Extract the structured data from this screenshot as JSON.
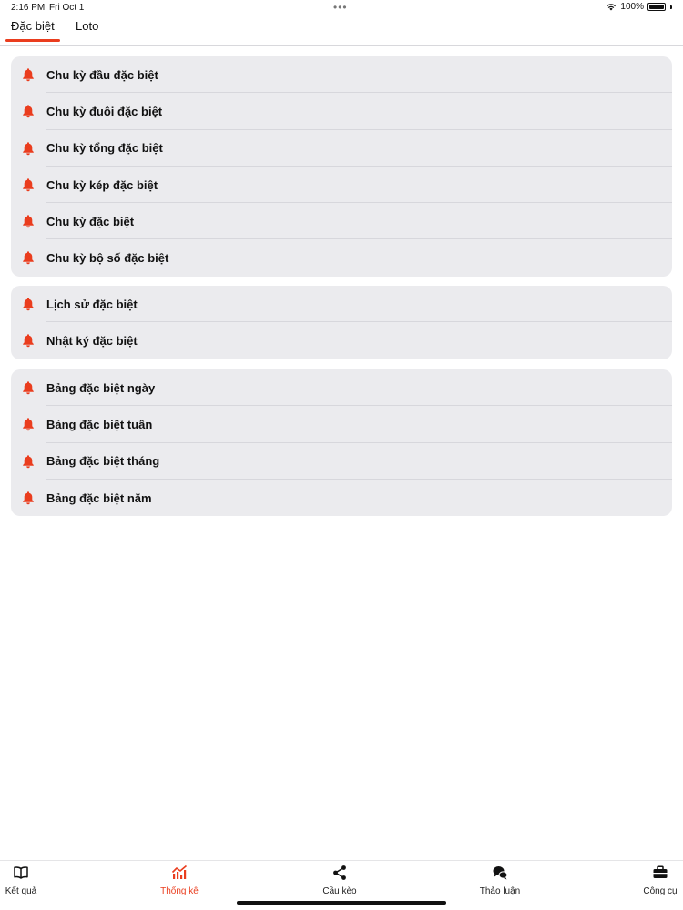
{
  "status_bar": {
    "time": "2:16 PM",
    "date": "Fri Oct 1",
    "battery": "100%",
    "icons": [
      "wifi-icon",
      "battery-icon"
    ]
  },
  "top_tabs": [
    {
      "label": "Đặc biệt",
      "active": true
    },
    {
      "label": "Loto",
      "active": false
    }
  ],
  "groups": [
    {
      "items": [
        {
          "label": "Chu kỳ đầu đặc biệt",
          "icon": "bell-icon"
        },
        {
          "label": "Chu kỳ đuôi đặc biệt",
          "icon": "bell-icon"
        },
        {
          "label": "Chu kỳ tổng đặc biệt",
          "icon": "bell-icon"
        },
        {
          "label": "Chu kỳ kép đặc biệt",
          "icon": "bell-icon"
        },
        {
          "label": "Chu kỳ đặc biệt",
          "icon": "bell-icon"
        },
        {
          "label": "Chu kỳ bộ số đặc biệt",
          "icon": "bell-icon"
        }
      ]
    },
    {
      "items": [
        {
          "label": "Lịch sử đặc biệt",
          "icon": "bell-icon"
        },
        {
          "label": "Nhật ký đặc biệt",
          "icon": "bell-icon"
        }
      ]
    },
    {
      "items": [
        {
          "label": "Bảng đặc biệt ngày",
          "icon": "bell-icon"
        },
        {
          "label": "Bảng đặc biệt tuần",
          "icon": "bell-icon"
        },
        {
          "label": "Bảng đặc biệt tháng",
          "icon": "bell-icon"
        },
        {
          "label": "Bảng đặc biệt năm",
          "icon": "bell-icon"
        }
      ]
    }
  ],
  "bottom_nav": [
    {
      "label": "Kết quả",
      "icon": "book-icon",
      "active": false
    },
    {
      "label": "Thống kê",
      "icon": "chart-icon",
      "active": true
    },
    {
      "label": "Cầu kèo",
      "icon": "share-icon",
      "active": false
    },
    {
      "label": "Thảo luận",
      "icon": "chat-icon",
      "active": false
    },
    {
      "label": "Công cụ",
      "icon": "toolbox-icon",
      "active": false
    }
  ],
  "colors": {
    "accent": "#ea3d1e",
    "group_bg": "#ebebee",
    "separator": "#d7d7dc"
  }
}
